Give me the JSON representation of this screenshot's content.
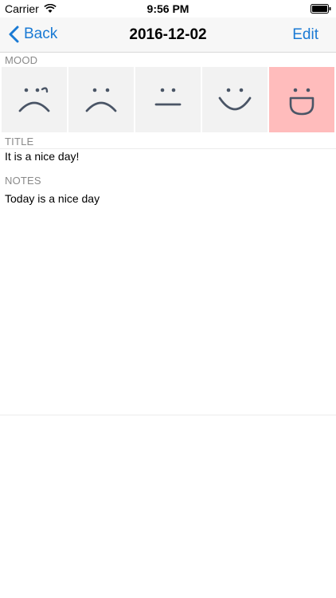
{
  "status_bar": {
    "carrier": "Carrier",
    "time": "9:56 PM"
  },
  "nav": {
    "back_label": "Back",
    "title": "2016-12-02",
    "edit_label": "Edit"
  },
  "mood": {
    "header": "MOOD",
    "options": [
      {
        "icon": "very-sad-face-icon",
        "selected": false
      },
      {
        "icon": "sad-face-icon",
        "selected": false
      },
      {
        "icon": "neutral-face-icon",
        "selected": false
      },
      {
        "icon": "happy-face-icon",
        "selected": false
      },
      {
        "icon": "very-happy-face-icon",
        "selected": true
      }
    ],
    "selected_color": "#ffbcbc"
  },
  "title_section": {
    "header": "TITLE",
    "value": "It is a nice day!"
  },
  "notes_section": {
    "header": "NOTES",
    "value": "Today is a nice day"
  },
  "colors": {
    "accent": "#1a7ad4",
    "face_stroke": "#4a5566"
  }
}
